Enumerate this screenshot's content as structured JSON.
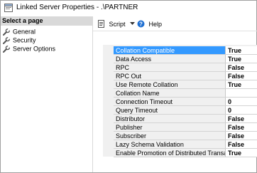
{
  "window": {
    "title": "Linked Server Properties - .\\PARTNER"
  },
  "left_panel": {
    "header": "Select a page",
    "items": [
      {
        "label": "General",
        "icon": "wrench-icon"
      },
      {
        "label": "Security",
        "icon": "wrench-icon"
      },
      {
        "label": "Server Options",
        "icon": "wrench-icon"
      }
    ]
  },
  "toolbar": {
    "script_label": "Script",
    "help_label": "Help"
  },
  "properties": [
    {
      "name": "Collation Compatible",
      "value": "True",
      "selected": true
    },
    {
      "name": "Data Access",
      "value": "True"
    },
    {
      "name": "RPC",
      "value": "False"
    },
    {
      "name": "RPC Out",
      "value": "False"
    },
    {
      "name": "Use Remote Collation",
      "value": "True"
    },
    {
      "name": "Collation Name",
      "value": ""
    },
    {
      "name": "Connection Timeout",
      "value": "0"
    },
    {
      "name": "Query Timeout",
      "value": "0"
    },
    {
      "name": "Distributor",
      "value": "False"
    },
    {
      "name": "Publisher",
      "value": "False"
    },
    {
      "name": "Subscriber",
      "value": "False"
    },
    {
      "name": "Lazy Schema Validation",
      "value": "False"
    },
    {
      "name": "Enable Promotion of Distributed Transaction",
      "value": "True"
    }
  ],
  "colors": {
    "selection": "#3399ff",
    "header_bg": "#d9d9d9",
    "grid_bg": "#f0f0f0"
  }
}
